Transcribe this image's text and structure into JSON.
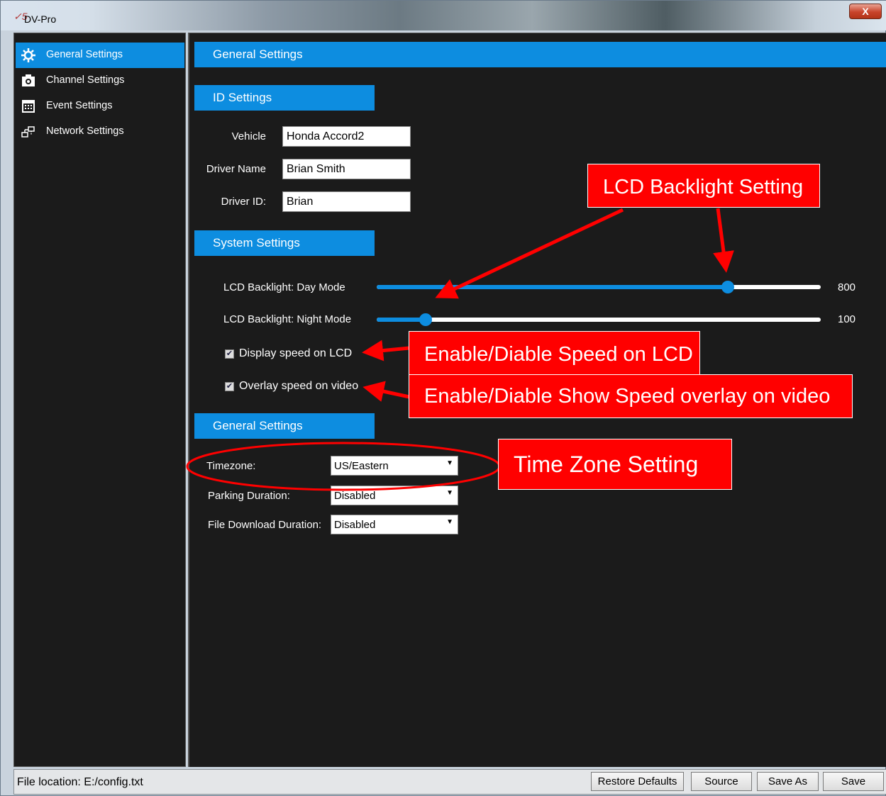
{
  "window": {
    "title": "DV-Pro",
    "logo_text": "✓5",
    "close_label": "X"
  },
  "sidebar": {
    "items": [
      {
        "label": "General Settings",
        "icon": "gear-icon",
        "active": true
      },
      {
        "label": "Channel Settings",
        "icon": "camera-icon",
        "active": false
      },
      {
        "label": "Event Settings",
        "icon": "calendar-icon",
        "active": false
      },
      {
        "label": "Network Settings",
        "icon": "network-icon",
        "active": false
      }
    ]
  },
  "main": {
    "header": "General Settings",
    "id_settings": {
      "title": "ID Settings",
      "vehicle_label": "Vehicle",
      "vehicle_value": "Honda Accord2",
      "driver_name_label": "Driver Name",
      "driver_name_value": "Brian Smith",
      "driver_id_label": "Driver ID:",
      "driver_id_value": "Brian"
    },
    "system_settings": {
      "title": "System Settings",
      "day_label": "LCD Backlight: Day Mode",
      "day_value": "800",
      "day_level": 0.79,
      "night_label": "LCD Backlight: Night Mode",
      "night_value": "100",
      "night_level": 0.11,
      "display_speed_label": "Display speed on LCD",
      "display_speed_checked": true,
      "overlay_speed_label": "Overlay speed on video",
      "overlay_speed_checked": true
    },
    "general_settings": {
      "title": "General Settings",
      "timezone_label": "Timezone:",
      "timezone_value": "US/Eastern",
      "parking_label": "Parking Duration:",
      "parking_value": "Disabled",
      "download_label": "File Download Duration:",
      "download_value": "Disabled"
    }
  },
  "statusbar": {
    "file_location": "File location: E:/config.txt",
    "buttons": {
      "restore": "Restore Defaults",
      "source": "Source",
      "save_as": "Save As",
      "save": "Save"
    }
  },
  "annotations": {
    "lcd_backlight": "LCD Backlight Setting",
    "speed_lcd": "Enable/Diable Speed on LCD",
    "speed_overlay": "Enable/Diable Show Speed overlay on video",
    "timezone": "Time Zone Setting"
  },
  "colors": {
    "accent": "#0d8de0",
    "panel_bg": "#1b1b1b",
    "callout_red": "#ff0000"
  }
}
